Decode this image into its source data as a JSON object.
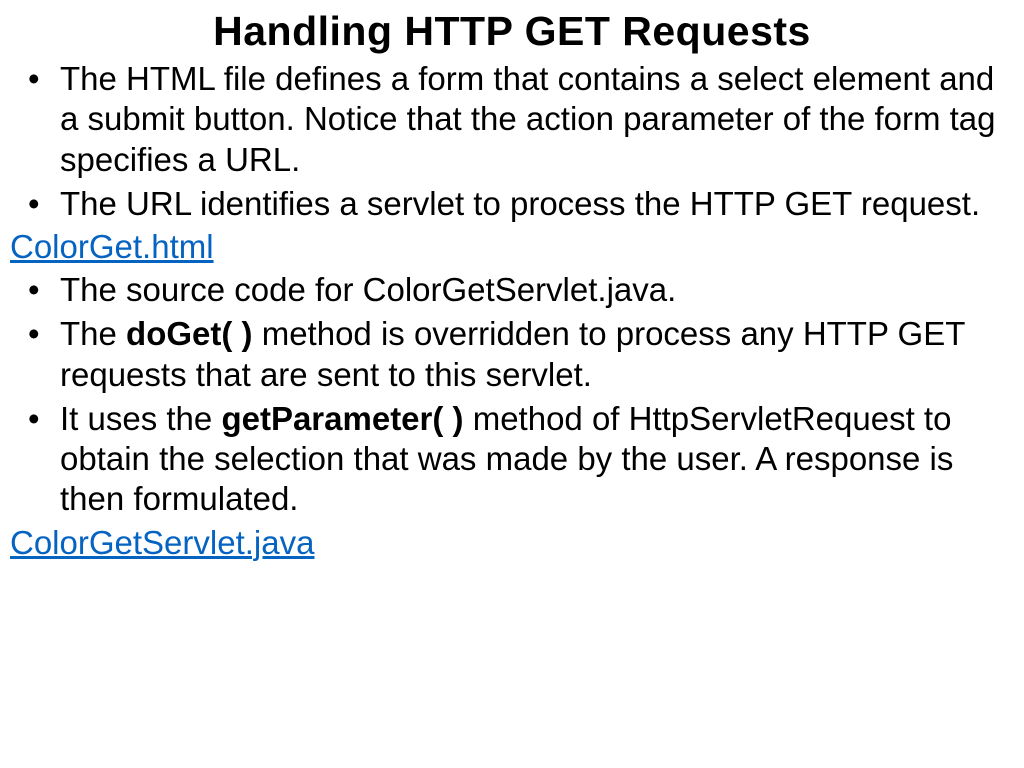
{
  "title": "Handling HTTP GET Requests",
  "bullets_a": [
    "The HTML file defines a form that contains a select element and a submit button. Notice that the action parameter of the form tag specifies a URL.",
    "The URL identifies a servlet to process the HTTP GET request."
  ],
  "link_a": "ColorGet.html",
  "bullets_b": {
    "item1": "The source code for ColorGetServlet.java.",
    "item2_pre": "The ",
    "item2_bold": "doGet( )",
    "item2_post": " method is overridden to process any HTTP GET requests that are sent to this servlet.",
    "item3_pre": "It uses the ",
    "item3_bold": "getParameter( )",
    "item3_post": " method of HttpServletRequest to obtain the selection that was made by the user. A response is then formulated."
  },
  "link_b": "ColorGetServlet.java"
}
